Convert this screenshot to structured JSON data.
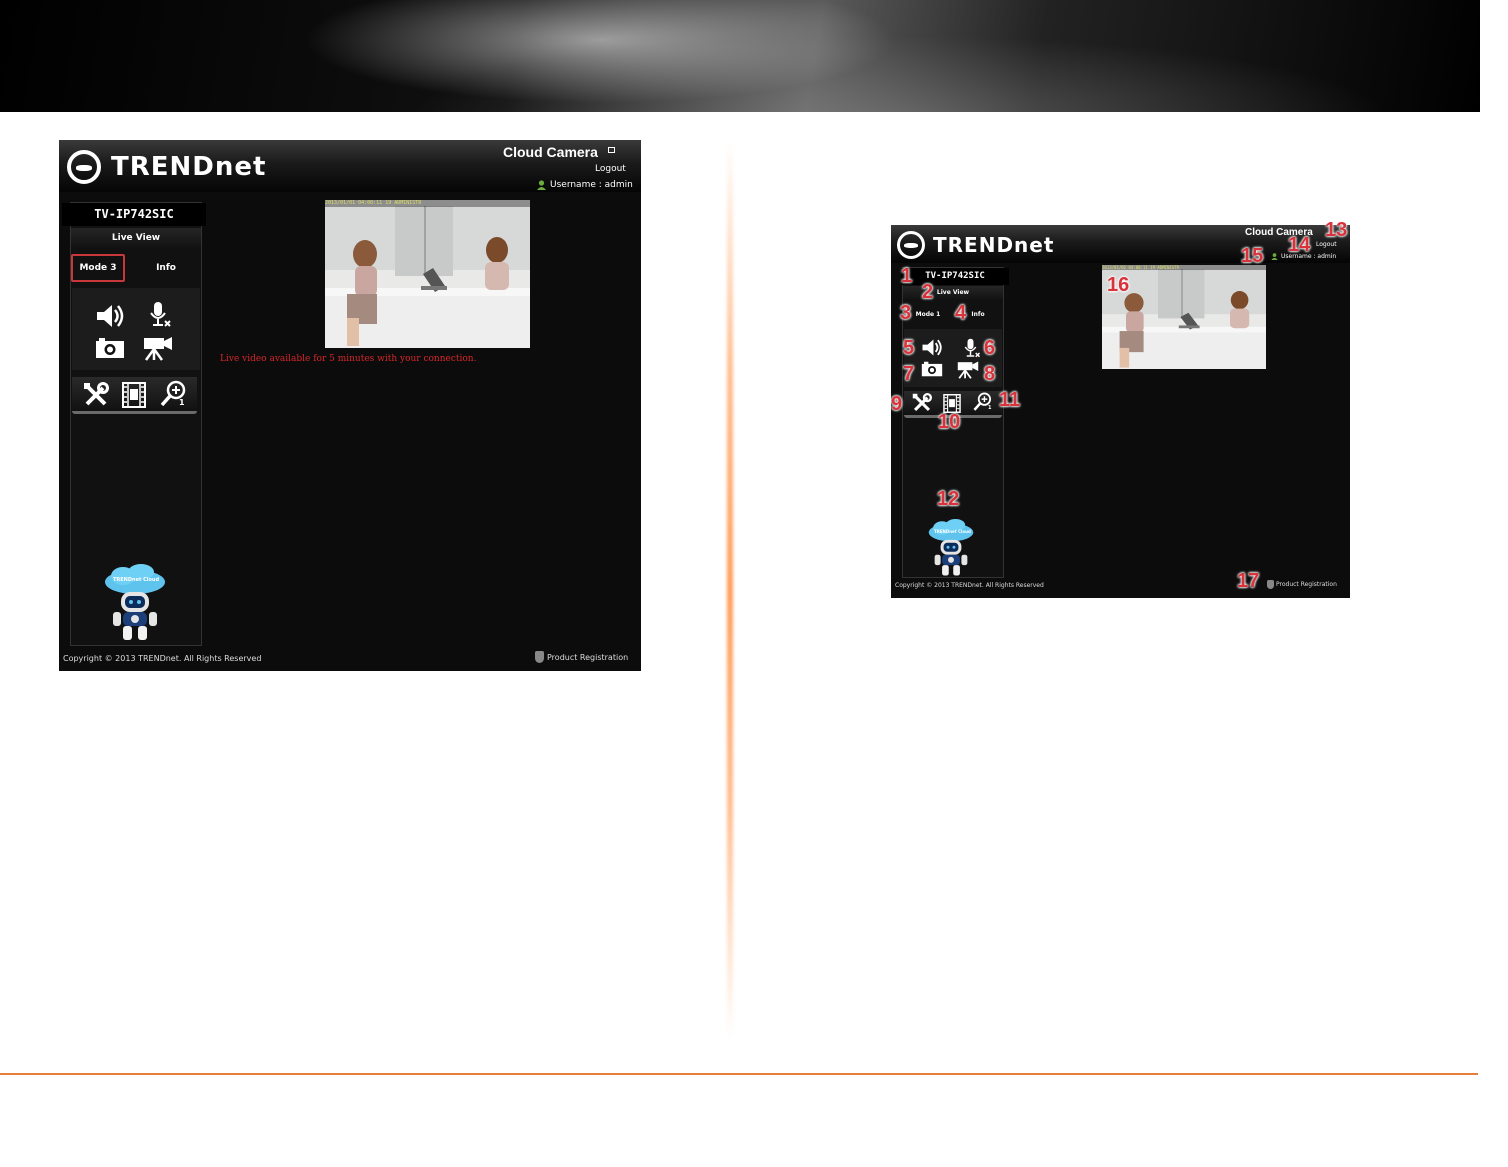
{
  "left_screen": {
    "brand": "TRENDnet",
    "app_title": "Cloud Camera",
    "logout": "Logout",
    "username": "Username : admin",
    "device_name": "TV-IP742SIC",
    "live_view": "Live View",
    "tabs": [
      {
        "label": "Mode 3",
        "highlighted": true
      },
      {
        "label": "Info"
      }
    ],
    "video_timestamp": "2013/01/01 04:00:11 19 ADMINISTR",
    "notice": "Live video available for 5 minutes with your connection.",
    "mascot_label": "TRENDnet Cloud",
    "copyright": "Copyright © 2013 TRENDnet. All Rights Reserved",
    "product_registration": "Product Registration",
    "zoom_level": "1"
  },
  "right_screen": {
    "brand": "TRENDnet",
    "app_title": "Cloud Camera",
    "logout": "Logout",
    "username": "Username : admin",
    "device_name": "TV-IP742SIC",
    "live_view": "Live View",
    "tabs": [
      {
        "label": "Mode 1"
      },
      {
        "label": "Info"
      }
    ],
    "video_timestamp": "2013/01/01 04:00:11 19 ADMINISTR",
    "mascot_label": "TRENDnet Cloud",
    "copyright": "Copyright © 2013 TRENDnet. All Rights Reserved",
    "product_registration": "Product Registration",
    "zoom_level": "1",
    "callouts": [
      "1",
      "2",
      "3",
      "4",
      "5",
      "6",
      "7",
      "8",
      "9",
      "10",
      "11",
      "12",
      "13",
      "14",
      "15",
      "16",
      "17"
    ]
  },
  "colors": {
    "callout_red": "#d9323a",
    "notice_red": "#d8262a",
    "divider_orange": "#e87c3a",
    "mode_highlight": "#c8373a"
  },
  "icons": [
    "speaker-icon",
    "microphone-mute-icon",
    "snapshot-camera-icon",
    "video-record-icon",
    "settings-tools-icon",
    "film-strip-icon",
    "zoom-in-icon",
    "user-icon",
    "shield-icon",
    "cloud-mascot-icon"
  ]
}
